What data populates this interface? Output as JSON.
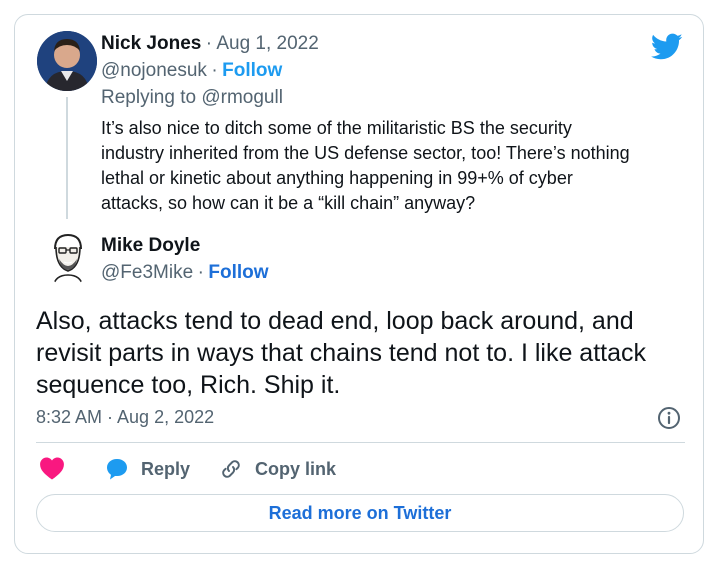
{
  "reply_tweet": {
    "author_name": "Nick Jones",
    "date": "· Aug 1, 2022",
    "handle": "@nojonesuk",
    "separator": "·",
    "follow_label": "Follow",
    "replying_to": "Replying to @rmogull",
    "text_lines": [
      "It’s also nice to ditch some of the militaristic BS the security",
      "industry inherited from the US defense sector, too! There’s nothing",
      "lethal or kinetic about anything happening in 99+% of cyber",
      "attacks, so how can it be a “kill chain” anyway?"
    ]
  },
  "main_tweet": {
    "author_name": "Mike Doyle",
    "handle": "@Fe3Mike",
    "separator": "·",
    "follow_label": "Follow",
    "text_lines": [
      "Also, attacks tend to dead end, loop back around, and",
      "revisit parts in ways that chains tend not to. I like attack",
      "sequence too, Rich. Ship it."
    ],
    "timestamp": "8:32 AM · Aug 2, 2022"
  },
  "actions": {
    "reply_label": "Reply",
    "copy_link_label": "Copy link"
  },
  "read_more_label": "Read more on Twitter",
  "colors": {
    "twitter_blue": "#1d9bf0",
    "follow_blue": "#1d6fd8",
    "like_pink": "#f91880",
    "muted_gray": "#536471",
    "border": "#cfd9de"
  },
  "icons": [
    "twitter-bird-icon",
    "info-icon",
    "heart-icon",
    "reply-bubble-icon",
    "link-icon"
  ]
}
